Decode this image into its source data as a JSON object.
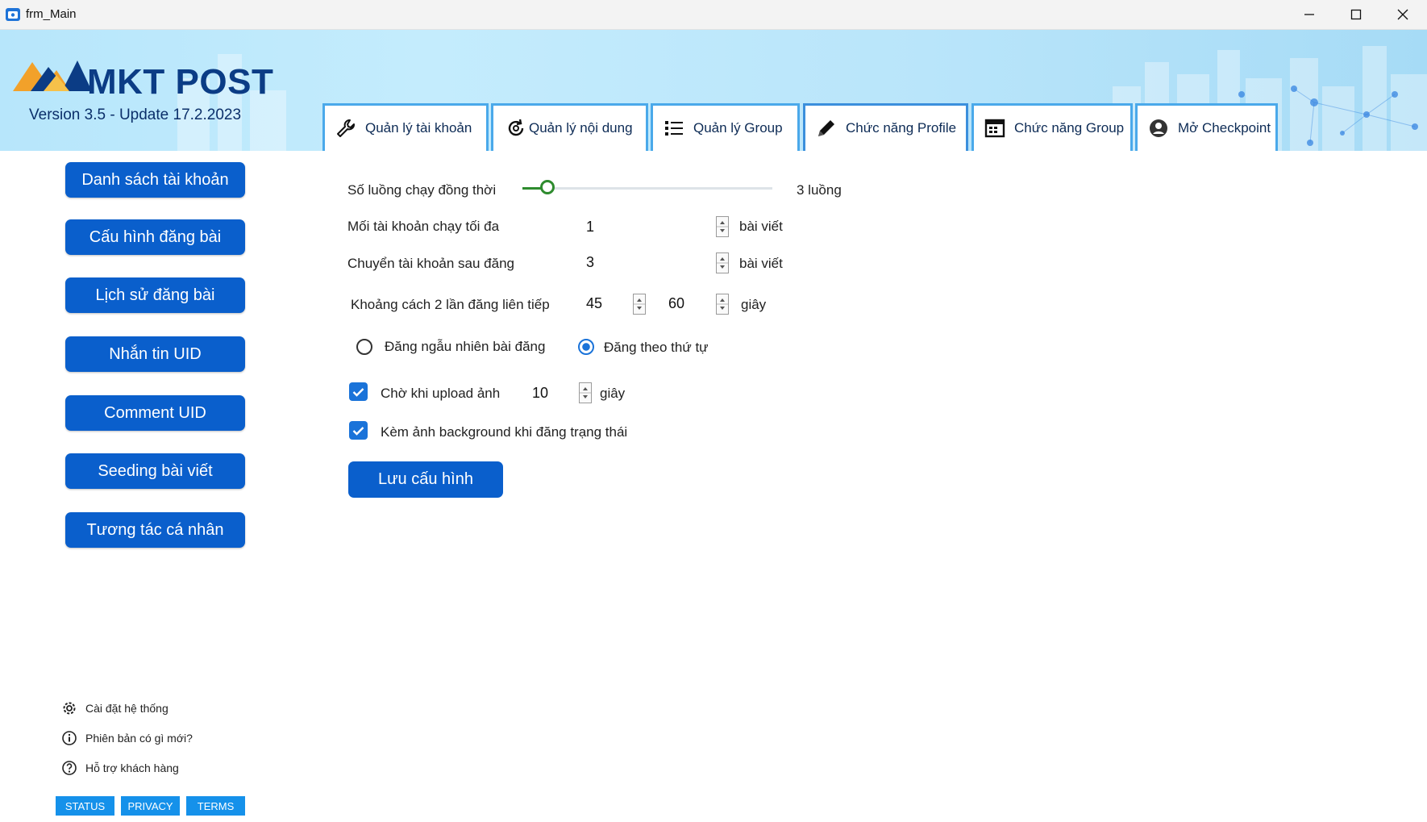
{
  "window": {
    "title": "frm_Main"
  },
  "header": {
    "logo_text": "MKT POST",
    "version": "Version 3.5 - Update 17.2.2023"
  },
  "tabs": [
    {
      "label": "Quản lý tài khoản",
      "icon": "wrench-icon"
    },
    {
      "label": "Quản lý nội dung",
      "icon": "refresh-cog-icon"
    },
    {
      "label": "Quản lý Group",
      "icon": "list-icon"
    },
    {
      "label": "Chức năng Profile",
      "icon": "pencil-icon",
      "active": true
    },
    {
      "label": "Chức năng Group",
      "icon": "calendar-grid-icon"
    },
    {
      "label": "Mở Checkpoint",
      "icon": "user-circle-icon"
    }
  ],
  "sidebar": {
    "items": [
      "Danh sách tài khoản",
      "Cấu hình đăng bài",
      "Lịch sử đăng bài",
      "Nhắn tin UID",
      "Comment UID",
      "Seeding bài viết",
      "Tương tác cá nhân"
    ],
    "footer_links": [
      {
        "label": "Cài đặt hệ thống",
        "icon": "gear-icon"
      },
      {
        "label": "Phiên bản có gì mới?",
        "icon": "info-icon"
      },
      {
        "label": "Hỗ trợ khách hàng",
        "icon": "help-icon"
      }
    ],
    "pills": [
      "STATUS",
      "PRIVACY",
      "TERMS"
    ]
  },
  "form": {
    "threads": {
      "label": "Số luồng chạy đồng thời",
      "value_text": "3 luồng",
      "slider_fraction": 0.1
    },
    "max_per_account": {
      "label": "Mối tài khoản chạy tối đa",
      "value": "1",
      "unit": "bài viết"
    },
    "switch_after": {
      "label": "Chuyển tài khoản sau đăng",
      "value": "3",
      "unit": "bài viết"
    },
    "interval": {
      "label": "Khoảng cách 2 lần đăng liên tiếp",
      "min": "45",
      "max": "60",
      "unit": "giây"
    },
    "order": {
      "random_label": "Đăng ngẫu nhiên bài đăng",
      "sequential_label": "Đăng theo thứ tự",
      "selected": "sequential"
    },
    "wait_upload": {
      "label": "Chờ khi upload ảnh",
      "value": "10",
      "unit": "giây",
      "checked": true
    },
    "background": {
      "label": "Kèm ảnh background khi đăng trạng thái",
      "checked": true
    },
    "save_label": "Lưu cấu hình"
  },
  "colors": {
    "primary": "#0a5fcc",
    "tab_border": "#4aa9ea",
    "slider_green": "#2e8b2e"
  }
}
